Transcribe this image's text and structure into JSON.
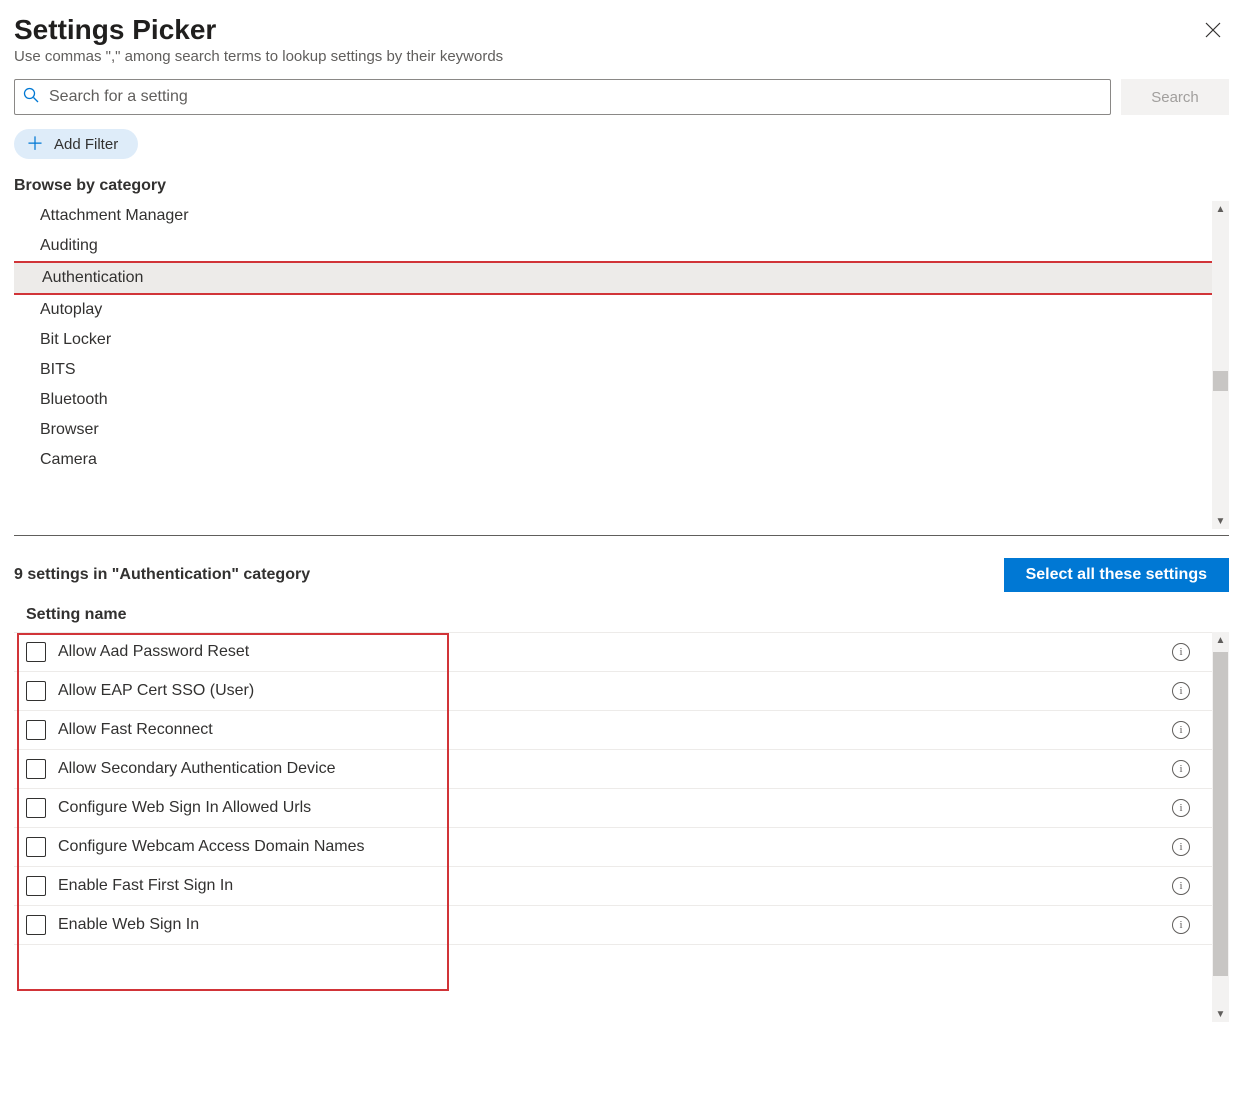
{
  "header": {
    "title": "Settings Picker",
    "subtitle": "Use commas \",\" among search terms to lookup settings by their keywords"
  },
  "search": {
    "placeholder": "Search for a setting",
    "button": "Search"
  },
  "addFilter": "Add Filter",
  "browseLabel": "Browse by category",
  "categories": [
    "Attachment Manager",
    "Auditing",
    "Authentication",
    "Autoplay",
    "Bit Locker",
    "BITS",
    "Bluetooth",
    "Browser",
    "Camera"
  ],
  "selectedCategoryIndex": 2,
  "resultsCount": "9 settings in \"Authentication\" category",
  "selectAll": "Select all these settings",
  "settingNameHeader": "Setting name",
  "settings": [
    "Allow Aad Password Reset",
    "Allow EAP Cert SSO (User)",
    "Allow Fast Reconnect",
    "Allow Secondary Authentication Device",
    "Configure Web Sign In Allowed Urls",
    "Configure Webcam Access Domain Names",
    "Enable Fast First Sign In",
    "Enable Web Sign In"
  ]
}
